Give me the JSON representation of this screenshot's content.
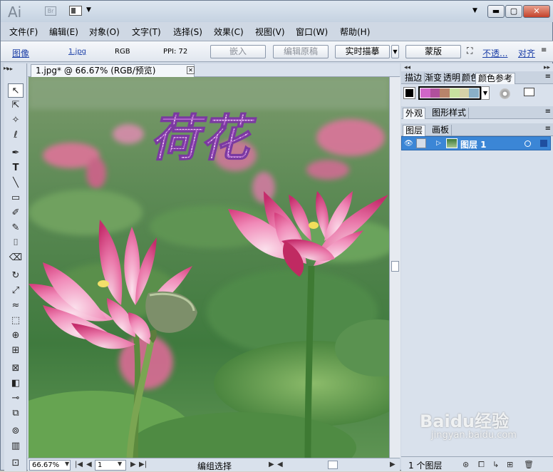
{
  "titlebar": {
    "logo": "Ai",
    "bridge_label": "Br",
    "min_icon": "minimize-icon",
    "max_icon": "maximize-icon",
    "close_icon": "close-icon"
  },
  "menus": [
    "文件(F)",
    "编辑(E)",
    "对象(O)",
    "文字(T)",
    "选择(S)",
    "效果(C)",
    "视图(V)",
    "窗口(W)",
    "帮助(H)"
  ],
  "control": {
    "type": "图像",
    "file": "1.jpg",
    "mode": "RGB",
    "ppi": "PPI: 72",
    "embed": "嵌入",
    "edit_original": "编辑原稿",
    "live_trace": "实时描摹",
    "mask": "蒙版",
    "opacity_link": "不透...",
    "align_link": "对齐"
  },
  "document": {
    "tab_title": "1.jpg* @ 66.67% (RGB/预览)",
    "tab_close": "⊠",
    "art_text": "荷花"
  },
  "status": {
    "zoom": "66.67%",
    "page": "1",
    "mode": "编组选择"
  },
  "panels": {
    "top_tabs": [
      "描边",
      "渐变",
      "透明",
      "颜色",
      "颜色参考"
    ],
    "mid_tabs": [
      "外观",
      "图形样式"
    ],
    "layer_tabs": [
      "图层",
      "画板"
    ],
    "layer_name": "图层 1",
    "layer_count": "1 个图层",
    "harmony_colors": [
      "#d066c8",
      "#b0509c",
      "#b8846a",
      "#c8e2a0",
      "#d8d2a8",
      "#8ab0c8"
    ]
  },
  "watermark": {
    "brand": "Baidu经验",
    "url": "jingyan.baidu.com"
  }
}
